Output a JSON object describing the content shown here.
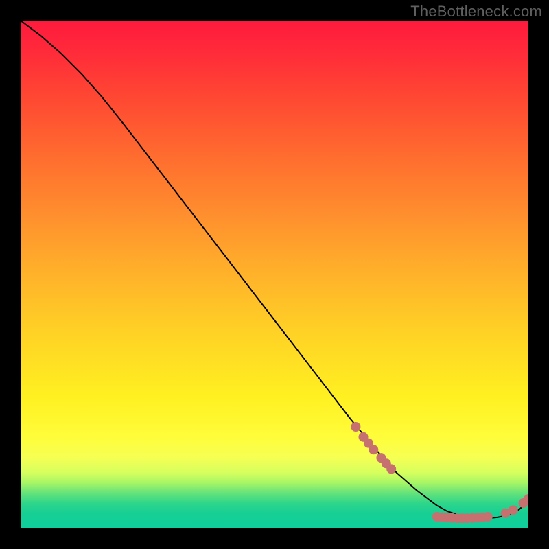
{
  "watermark": "TheBottleneck.com",
  "chart_data": {
    "type": "line",
    "title": "",
    "xlabel": "",
    "ylabel": "",
    "xlim": [
      0,
      100
    ],
    "ylim": [
      0,
      100
    ],
    "series": [
      {
        "name": "curve",
        "x": [
          0,
          4,
          8,
          12,
          16,
          20,
          25,
          30,
          35,
          40,
          45,
          50,
          55,
          60,
          65,
          70,
          74,
          78,
          82,
          84,
          86,
          88,
          90,
          92,
          94,
          96,
          98,
          100
        ],
        "y": [
          100,
          97,
          93.5,
          89.5,
          85,
          80,
          73.5,
          67,
          60.5,
          54,
          47.5,
          41,
          34.5,
          28,
          21.5,
          15.5,
          11,
          7.5,
          4.5,
          3.4,
          2.7,
          2.2,
          2.0,
          2.0,
          2.2,
          2.6,
          3.6,
          5.3
        ]
      }
    ],
    "markers": [
      {
        "name": "cluster-a",
        "points": [
          {
            "x": 66.0,
            "y": 20.0
          },
          {
            "x": 67.5,
            "y": 18.0
          },
          {
            "x": 68.5,
            "y": 16.8
          },
          {
            "x": 69.5,
            "y": 15.5
          },
          {
            "x": 71.0,
            "y": 13.9
          },
          {
            "x": 72.0,
            "y": 12.8
          },
          {
            "x": 73.0,
            "y": 11.7
          }
        ]
      },
      {
        "name": "cluster-b",
        "points": [
          {
            "x": 82.0,
            "y": 2.3
          },
          {
            "x": 83.0,
            "y": 2.2
          },
          {
            "x": 84.0,
            "y": 2.1
          },
          {
            "x": 85.0,
            "y": 2.05
          },
          {
            "x": 86.0,
            "y": 2.0
          },
          {
            "x": 87.0,
            "y": 2.0
          },
          {
            "x": 88.0,
            "y": 2.0
          },
          {
            "x": 89.0,
            "y": 2.05
          },
          {
            "x": 90.0,
            "y": 2.1
          },
          {
            "x": 91.0,
            "y": 2.2
          },
          {
            "x": 92.0,
            "y": 2.3
          }
        ]
      },
      {
        "name": "cluster-c",
        "points": [
          {
            "x": 95.5,
            "y": 3.0
          },
          {
            "x": 97.0,
            "y": 3.6
          },
          {
            "x": 99.0,
            "y": 5.0
          },
          {
            "x": 100.0,
            "y": 5.8
          }
        ]
      }
    ],
    "marker_style": {
      "fill": "#c77070",
      "radius_px": 7
    }
  }
}
